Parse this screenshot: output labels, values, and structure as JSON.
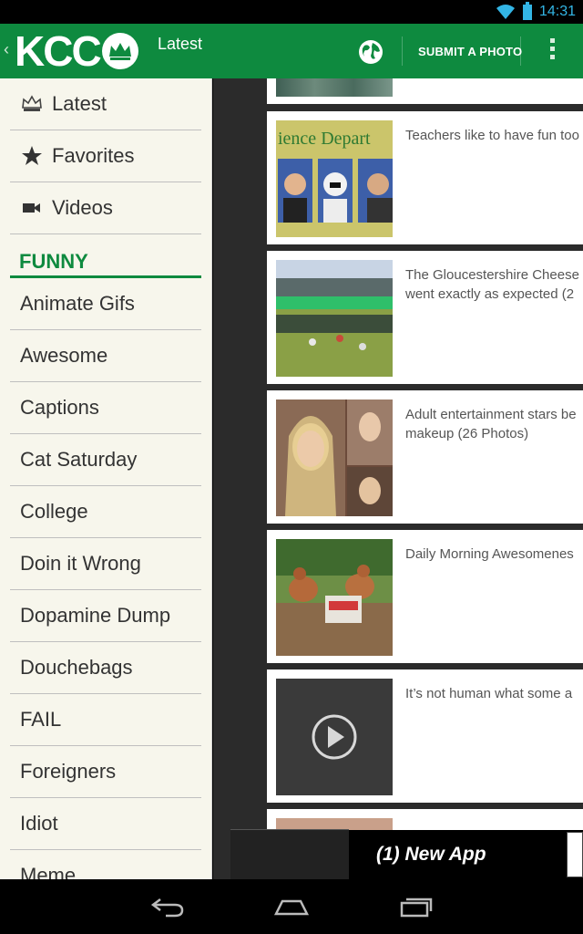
{
  "status_bar": {
    "time": "14:31"
  },
  "action_bar": {
    "logo_text": "KCC",
    "title": "Latest",
    "submit_label": "SUBMIT A PHOTO",
    "brand_color": "#0e8a3f"
  },
  "drawer": {
    "nav": [
      {
        "label": "Latest",
        "icon": "crown-icon"
      },
      {
        "label": "Favorites",
        "icon": "star-icon"
      },
      {
        "label": "Videos",
        "icon": "video-camera-icon"
      }
    ],
    "section_title": "FUNNY",
    "categories": [
      "Animate Gifs",
      "Awesome",
      "Captions",
      "Cat Saturday",
      "College",
      "Doin it Wrong",
      "Dopamine Dump",
      "Douchebags",
      "FAIL",
      "Foreigners",
      "Idiot",
      "Meme"
    ]
  },
  "feed": [
    {
      "text": "Teachers like to have fun too"
    },
    {
      "text": "The Gloucestershire Cheese\nwent exactly as expected (2"
    },
    {
      "text": "Adult entertainment stars be\nmakeup (26 Photos)"
    },
    {
      "text": "Daily Morning Awesomenes"
    },
    {
      "text": "It’s not human what some a"
    }
  ],
  "ad": {
    "text": "(1) New App"
  }
}
